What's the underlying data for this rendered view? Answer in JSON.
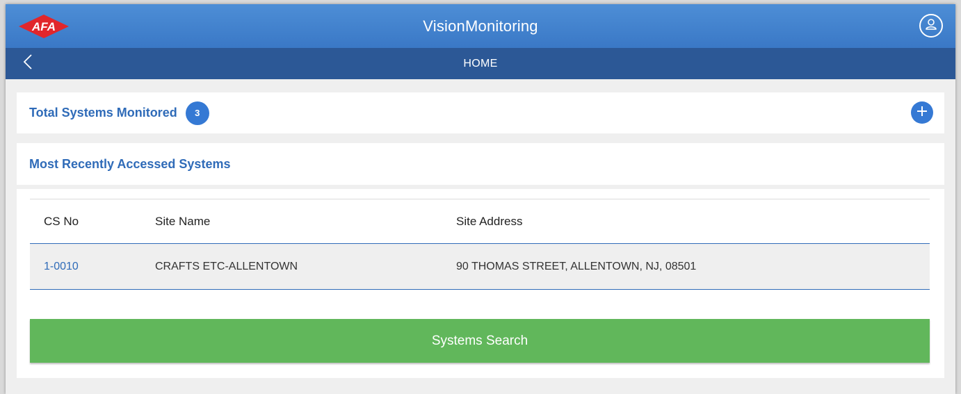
{
  "header": {
    "logo_text": "AFA",
    "title": "VisionMonitoring"
  },
  "nav": {
    "title": "HOME"
  },
  "total_systems": {
    "label": "Total Systems Monitored",
    "count": "3"
  },
  "recent": {
    "label": "Most Recently Accessed Systems"
  },
  "table": {
    "columns": [
      "CS No",
      "Site Name",
      "Site Address"
    ],
    "rows": [
      {
        "cs_no": "1-0010",
        "site_name": "CRAFTS ETC-ALLENTOWN",
        "site_address": "90 THOMAS STREET, ALLENTOWN, NJ, 08501"
      }
    ]
  },
  "search_button": {
    "label": "Systems Search"
  },
  "colors": {
    "header_blue": "#3a78c6",
    "nav_blue": "#2c5896",
    "accent_blue": "#3579d4",
    "green": "#61b75b"
  },
  "icons": {
    "back": "chevron-left-icon",
    "user": "user-icon",
    "add": "plus-icon"
  }
}
